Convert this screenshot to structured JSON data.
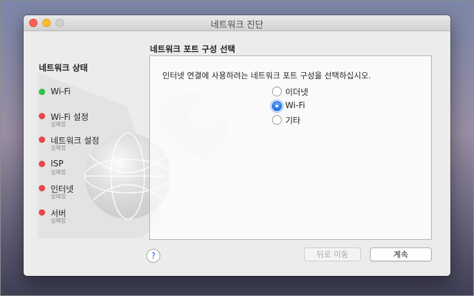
{
  "window": {
    "title": "네트워크 진단"
  },
  "sidebar": {
    "title": "네트워크 상태",
    "items": [
      {
        "label": "Wi-Fi",
        "status": "ok",
        "color": "#28c840"
      },
      {
        "label": "Wi-Fi 설정",
        "sub": "실패함",
        "status": "failed",
        "color": "#f0474a"
      },
      {
        "label": "네트워크 설정",
        "sub": "실패함",
        "status": "failed",
        "color": "#f0474a"
      },
      {
        "label": "ISP",
        "sub": "실패함",
        "status": "failed",
        "color": "#f0474a"
      },
      {
        "label": "인터넷",
        "sub": "실패함",
        "status": "failed",
        "color": "#f0474a"
      },
      {
        "label": "서버",
        "sub": "실패함",
        "status": "failed",
        "color": "#f0474a"
      }
    ]
  },
  "main": {
    "section_title": "네트워크 포트 구성 선택",
    "instruction": "인터넷 연결에 사용하려는 네트워크 포트 구성을 선택하십시오.",
    "options": [
      {
        "label": "이더넷",
        "selected": false
      },
      {
        "label": "Wi-Fi",
        "selected": true
      },
      {
        "label": "기타",
        "selected": false
      }
    ]
  },
  "footer": {
    "help_label": "?",
    "back_label": "뒤로 이동",
    "continue_label": "계속"
  },
  "colors": {
    "accent": "#1f6ee8",
    "ok": "#28c840",
    "fail": "#f0474a"
  }
}
